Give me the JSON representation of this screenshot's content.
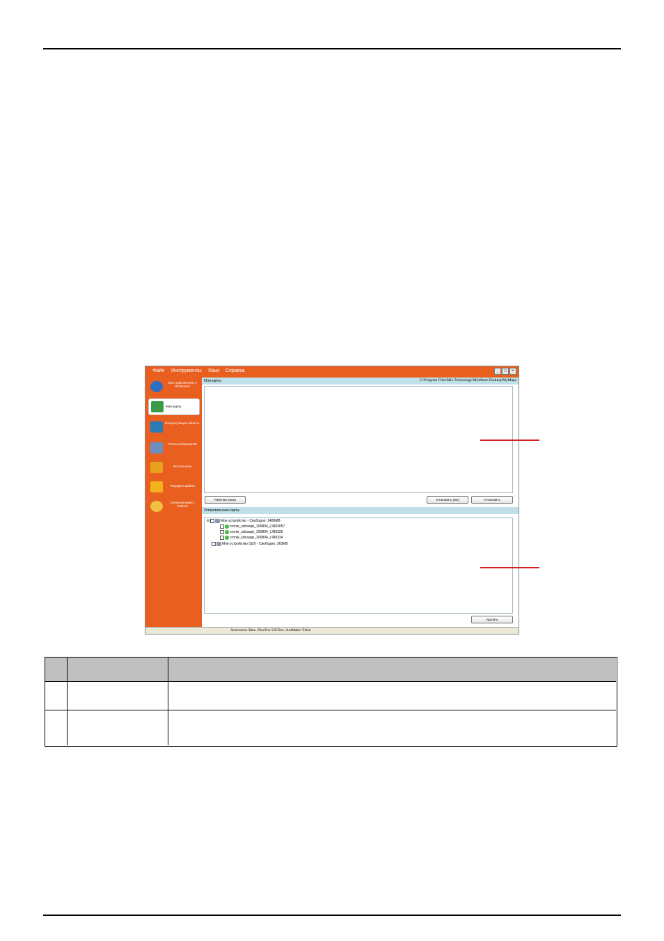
{
  "app": {
    "menu": [
      "Файл",
      "Инструменты",
      "Язык",
      "Справка"
    ],
    "window_buttons": [
      "minimize-icon",
      "maximize-icon",
      "close-icon"
    ],
    "sidebar": [
      {
        "label": "Мое подключение к Интернету",
        "icon": "globe-icon",
        "color": "#2d6fc4"
      },
      {
        "label": "Мои карты",
        "icon": "maps-icon",
        "color": "#3a9a46",
        "active": true
      },
      {
        "label": "Интересующая область",
        "icon": "area-icon",
        "color": "#2a7ab8"
      },
      {
        "label": "Поиск изображений",
        "icon": "image-search-icon",
        "color": "#6a8fc0"
      },
      {
        "label": "Фотоальбом",
        "icon": "album-icon",
        "color": "#e6a21c"
      },
      {
        "label": "Передача файла",
        "icon": "file-transfer-icon",
        "color": "#f2b21c"
      },
      {
        "label": "Синхронизация с Outlook",
        "icon": "outlook-sync-icon",
        "color": "#f0c040"
      }
    ],
    "my_maps": {
      "title": "Мои карты",
      "path": "C:\\Program Files\\Mio Technology\\MioMore Desktop\\MyMaps",
      "buttons": {
        "work_folder": "Рабочая папка",
        "install_sd": "Установить (SD)",
        "install": "Установить"
      }
    },
    "installed_maps": {
      "title": "Установленные карты",
      "tree": [
        {
          "text": "Мое устройство - Свободно: 1480MB",
          "level": 0,
          "kind": "device",
          "expander": "⊟"
        },
        {
          "text": "cronie_sdcaaqe_200804_LIR03057",
          "level": 1,
          "kind": "map"
        },
        {
          "text": "cronie_sdcaaqe_200804_LIR0325",
          "level": 1,
          "kind": "map"
        },
        {
          "text": "cronie_sdcaaqe_200804_LIR0334",
          "level": 1,
          "kind": "map"
        },
        {
          "text": "Мое устройство (SD) - Свободно: 363MB",
          "level": 0,
          "kind": "device",
          "expander": ""
        }
      ],
      "delete_button": "Удалить"
    },
    "status": "Activation: Beta  |  NavFox UKTest  |  AntMake=False",
    "callout_color": "#d42020",
    "accent_color": "#e85f1f"
  },
  "table": {
    "header": [
      "",
      "",
      ""
    ],
    "rows": [
      [
        "",
        "",
        ""
      ],
      [
        "",
        "",
        ""
      ]
    ]
  }
}
